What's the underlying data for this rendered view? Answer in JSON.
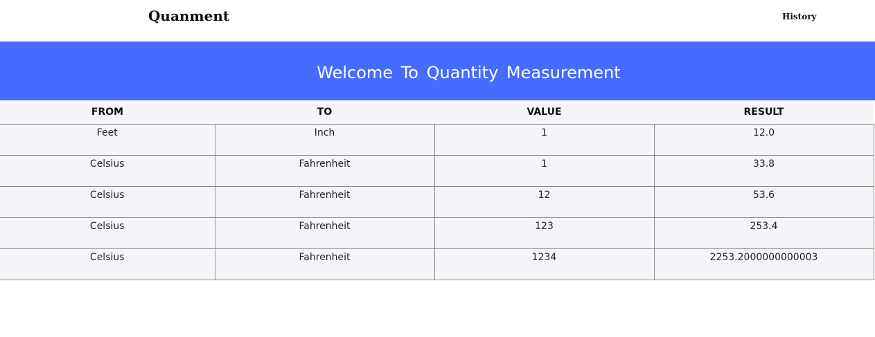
{
  "navbar": {
    "brand": "Quanment",
    "history_label": "History"
  },
  "hero": {
    "title": "Welcome To Quantity Measurement"
  },
  "table": {
    "headers": [
      "FROM",
      "TO",
      "VALUE",
      "RESULT"
    ],
    "rows": [
      [
        "Feet",
        "Inch",
        "1",
        "12.0"
      ],
      [
        "Celsius",
        "Fahrenheit",
        "1",
        "33.8"
      ],
      [
        "Celsius",
        "Fahrenheit",
        "12",
        "53.6"
      ],
      [
        "Celsius",
        "Fahrenheit",
        "123",
        "253.4"
      ],
      [
        "Celsius",
        "Fahrenheit",
        "1234",
        "2253.2000000000003"
      ]
    ]
  },
  "colors": {
    "hero_background": "#456bff",
    "table_background": "#f4f5f8",
    "cell_border": "#8c8c8c"
  }
}
